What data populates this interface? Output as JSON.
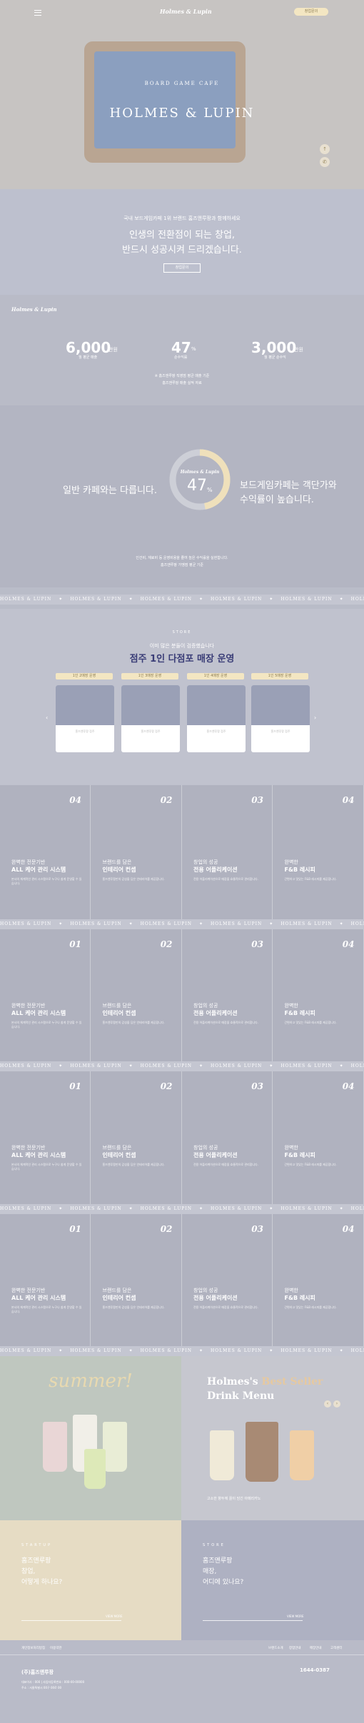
{
  "header": {
    "logo": "Holmes & Lupin",
    "cta": "창업문의"
  },
  "hero": {
    "subtitle": "BOARD GAME CAFE",
    "title": "HOLMES & LUPIN"
  },
  "intro": {
    "small": "국내 보드게임카페 1위 브랜드 홈즈앤루팡과 함께하세요",
    "line1": "인생의 전환점이 되는 창업,",
    "line2": "반드시 성공시켜 드리겠습니다.",
    "button": "창업문의"
  },
  "stats": {
    "logo": "Holmes & Lupin",
    "items": [
      {
        "value": "6,000",
        "unit": "만원",
        "caption": "월 평균 매출"
      },
      {
        "value": "47",
        "unit": "%",
        "caption": "순수익률"
      },
      {
        "value": "3,000",
        "unit": "만원",
        "caption": "월 평균 순수익"
      }
    ],
    "note1": "※ 홈즈앤루팡 직영점 평균 매출 기준",
    "note2": "홈즈앤루팡 매출 실적 자료"
  },
  "compare": {
    "left": "일반 카페와는 다릅니다.",
    "gauge_logo": "Holmes & Lupin",
    "gauge_value": "47",
    "gauge_unit": "%",
    "gauge_fraction": 0.47,
    "right": "보드게임카페는 객단가와 수익률이 높습니다.",
    "note1": "인건비, 재료비 등 운영비용을 줄여 높은 수익률을 실현합니다.",
    "note2": "홈즈앤루팡 가맹점 평균 기준"
  },
  "band_text": "HOLMES & LUPIN",
  "stores": {
    "eyebrow": "STORE",
    "sub": "이미 많은 분들이 검증했습니다",
    "title": "점주 1인 다점포 매장 운영",
    "tabs": [
      "1인 2매장 운영",
      "1인 3매장 운영",
      "1인 4매장 운영",
      "1인 5매장 운영"
    ],
    "captions": [
      "홈즈앤루팡 점주",
      "홈즈앤루팡 점주",
      "홈즈앤루팡 점주",
      "홈즈앤루팡 점주"
    ]
  },
  "features": [
    {
      "num": "04",
      "k1": "완벽한 전문기반",
      "k2": "ALL 케어 관리 시스템",
      "desc": "본사의 체계적인 관리 시스템으로 누구나 쉽게 운영할 수 있습니다."
    },
    {
      "num": "02",
      "k1": "브랜드를 담은",
      "k2": "인테리어 컨셉",
      "desc": "홈즈앤루팡만의 감성을 담은 인테리어를 제공합니다."
    },
    {
      "num": "03",
      "k1": "창업의 성공",
      "k2": "전용 어플리케이션",
      "desc": "전용 어플리케이션으로 매장을 효율적으로 관리합니다."
    },
    {
      "num": "04",
      "k1": "완벽한",
      "k2": "F&B 레시피",
      "desc": "간편하고 맛있는 F&B 레시피를 제공합니다."
    }
  ],
  "features2": [
    {
      "num": "01",
      "k1": "완벽한 전문기반",
      "k2": "ALL 케어 관리 시스템",
      "desc": "본사의 체계적인 관리 시스템으로 누구나 쉽게 운영할 수 있습니다."
    },
    {
      "num": "02",
      "k1": "브랜드를 담은",
      "k2": "인테리어 컨셉",
      "desc": "홈즈앤루팡만의 감성을 담은 인테리어를 제공합니다."
    },
    {
      "num": "03",
      "k1": "창업의 성공",
      "k2": "전용 어플리케이션",
      "desc": "전용 어플리케이션으로 매장을 효율적으로 관리합니다."
    },
    {
      "num": "04",
      "k1": "완벽한",
      "k2": "F&B 레시피",
      "desc": "간편하고 맛있는 F&B 레시피를 제공합니다."
    }
  ],
  "drinks": {
    "season": "summer!",
    "title1": "Holmes's",
    "title_accent": "Best Seller",
    "title2": "Drink Menu",
    "caption": "고소한 향두께 꿀이 담긴 아메리카노"
  },
  "cta": {
    "left_eye": "STARTUP",
    "left_title1": "홈즈앤루팡",
    "left_title2": "창업,",
    "left_title3": "어떻게 하나요?",
    "right_eye": "STORE",
    "right_title1": "홈즈앤루팡",
    "right_title2": "매장,",
    "right_title3": "어디에 있나요?",
    "more": "VIEW MORE"
  },
  "footer": {
    "links_left": [
      "개인정보처리방침",
      "이용약관"
    ],
    "links_right": [
      "브랜드소개",
      "창업안내",
      "매장안내",
      "고객센터"
    ],
    "company": "(주)홈즈앤루팡",
    "info1": "대표이사 : 000  |  사업자등록번호 : 000-00-00000",
    "info2": "주소 : 서울특별시 00구 00로 00",
    "tel": "1644-0387"
  }
}
